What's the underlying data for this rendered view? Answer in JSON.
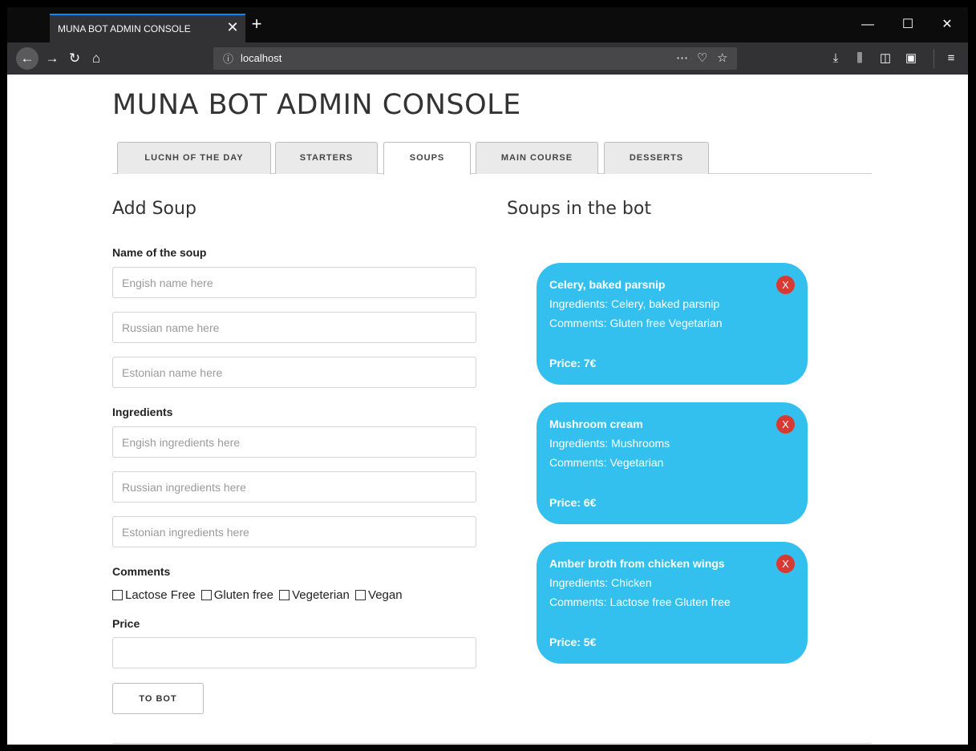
{
  "browser": {
    "tab_title": "MUNA BOT ADMIN CONSOLE",
    "url": "localhost",
    "accent": "#0a84ff"
  },
  "page": {
    "title": "MUNA BOT ADMIN CONSOLE",
    "tabs": [
      {
        "label": "LUCNH OF THE DAY",
        "active": false
      },
      {
        "label": "STARTERS",
        "active": false
      },
      {
        "label": "SOUPS",
        "active": true
      },
      {
        "label": "MAIN COURSE",
        "active": false
      },
      {
        "label": "DESSERTS",
        "active": false
      }
    ]
  },
  "form": {
    "heading": "Add Soup",
    "name_label": "Name of the soup",
    "name_en_placeholder": "Engish name here",
    "name_ru_placeholder": "Russian name here",
    "name_et_placeholder": "Estonian name here",
    "ingredients_label": "Ingredients",
    "ing_en_placeholder": "Engish ingredients here",
    "ing_ru_placeholder": "Russian ingredients here",
    "ing_et_placeholder": "Estonian ingredients here",
    "comments_label": "Comments",
    "checkboxes": [
      "Lactose Free",
      "Gluten free",
      "Vegeterian",
      "Vegan"
    ],
    "price_label": "Price",
    "price_value": "",
    "submit_label": "TO BOT"
  },
  "list": {
    "heading": "Soups in the bot",
    "card_color": "#33c0ee",
    "delete_color": "#d73a33",
    "delete_label": "X",
    "items": [
      {
        "name": "Celery, baked parsnip",
        "ingredients": "Ingredients: Celery, baked parsnip",
        "comments": "Comments: Gluten free Vegetarian",
        "price": "Price: 7€"
      },
      {
        "name": "Mushroom cream",
        "ingredients": "Ingredients: Mushrooms",
        "comments": "Comments: Vegetarian",
        "price": "Price: 6€"
      },
      {
        "name": "Amber broth from chicken wings",
        "ingredients": "Ingredients: Chicken",
        "comments": "Comments: Lactose free Gluten free",
        "price": "Price: 5€"
      }
    ]
  }
}
